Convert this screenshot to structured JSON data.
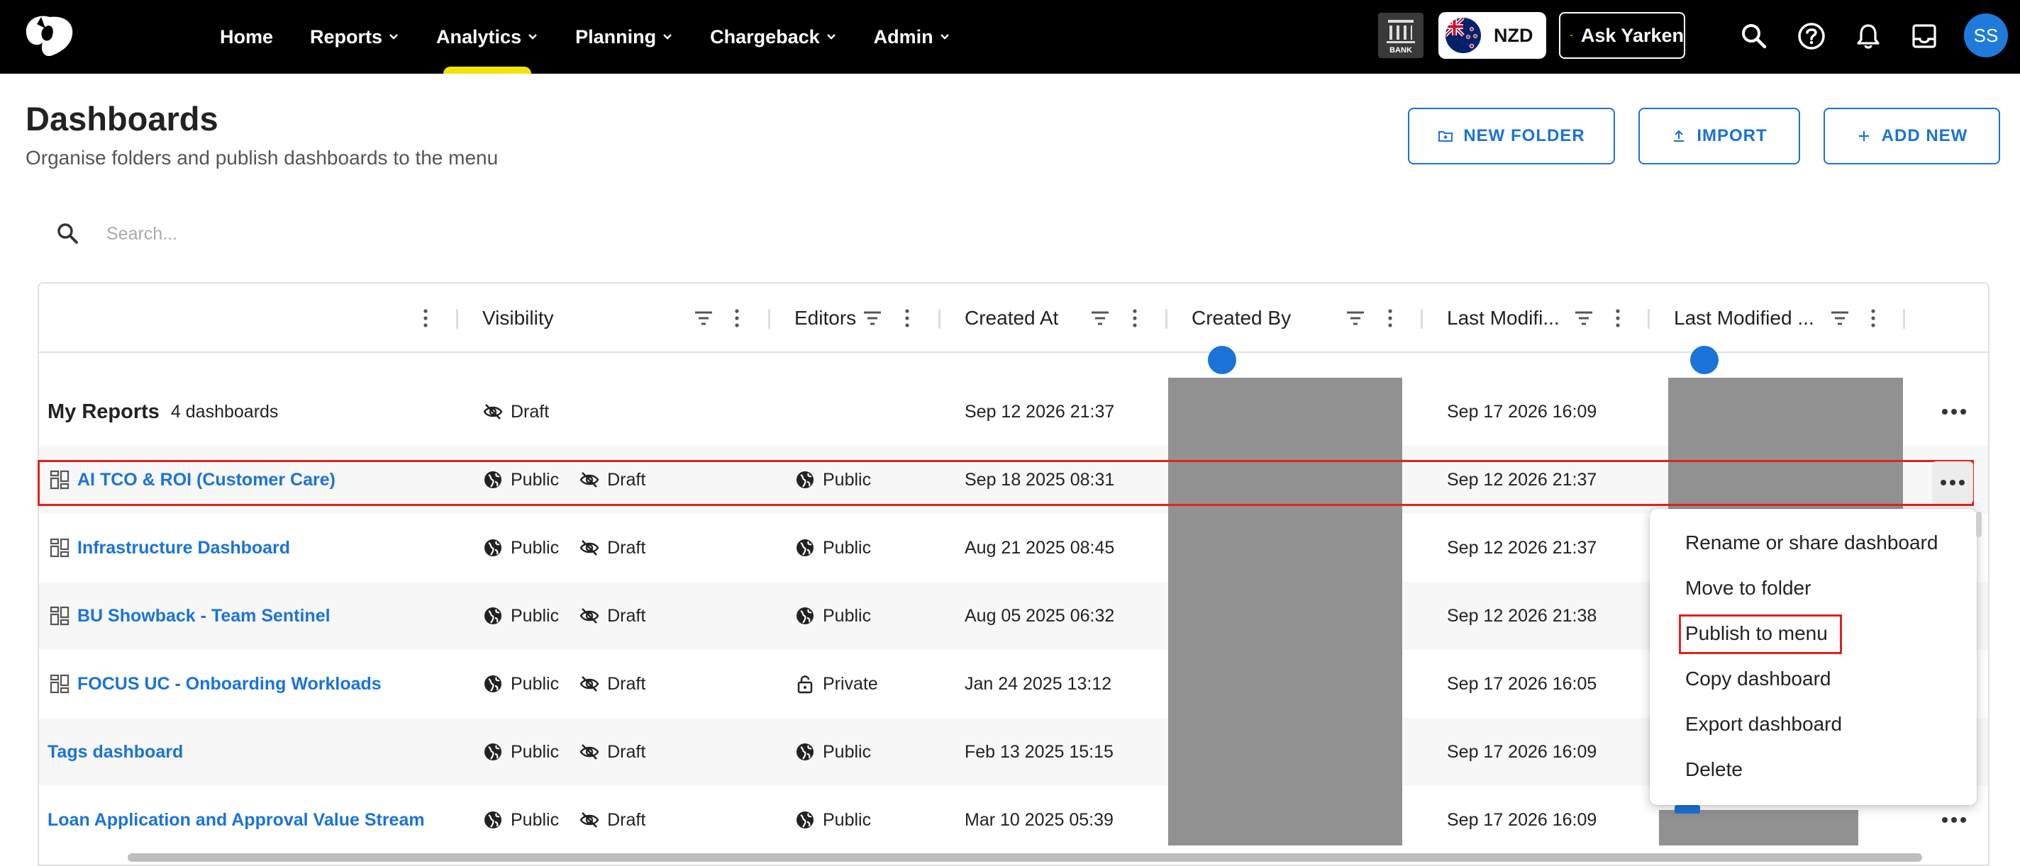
{
  "nav": {
    "items": [
      {
        "label": "Home",
        "has_menu": false,
        "active": false
      },
      {
        "label": "Reports",
        "has_menu": true,
        "active": false
      },
      {
        "label": "Analytics",
        "has_menu": true,
        "active": true
      },
      {
        "label": "Planning",
        "has_menu": true,
        "active": false
      },
      {
        "label": "Chargeback",
        "has_menu": true,
        "active": false
      },
      {
        "label": "Admin",
        "has_menu": true,
        "active": false
      }
    ],
    "bank_label": "BANK",
    "currency": "NZD",
    "ask_label": "Ask Yarken",
    "avatar_initials": "SS",
    "active_indicator_color": "#f4e20c"
  },
  "page": {
    "title": "Dashboards",
    "subtitle": "Organise folders and publish dashboards to the menu",
    "buttons": {
      "new_folder": "NEW FOLDER",
      "import": "IMPORT",
      "add_new": "ADD NEW"
    }
  },
  "search": {
    "placeholder": "Search...",
    "value": ""
  },
  "table": {
    "columns": [
      "",
      "Visibility",
      "Editors",
      "Created At",
      "Created By",
      "Last Modifi...",
      "Last Modified ..."
    ],
    "folder": {
      "name": "My Reports",
      "count": "4 dashboards",
      "visibility": "Draft",
      "created_at": "Sep 12 2026 21:37",
      "last_modified": "Sep 17 2026 16:09"
    },
    "rows": [
      {
        "name": "AI TCO & ROI (Customer Care)",
        "in_folder": true,
        "visibility_public": "Public",
        "visibility_draft": "Draft",
        "editors": "Public",
        "editors_icon": "globe-icon",
        "created_at": "Sep 18 2025 08:31",
        "last_modified": "Sep 12 2026 21:37",
        "selected": true
      },
      {
        "name": "Infrastructure Dashboard",
        "in_folder": true,
        "visibility_public": "Public",
        "visibility_draft": "Draft",
        "editors": "Public",
        "editors_icon": "globe-icon",
        "created_at": "Aug 21 2025 08:45",
        "last_modified": "Sep 12 2026 21:37",
        "selected": false
      },
      {
        "name": "BU Showback - Team Sentinel",
        "in_folder": true,
        "visibility_public": "Public",
        "visibility_draft": "Draft",
        "editors": "Public",
        "editors_icon": "globe-icon",
        "created_at": "Aug 05 2025 06:32",
        "last_modified": "Sep 12 2026 21:38",
        "selected": false
      },
      {
        "name": "FOCUS UC - Onboarding Workloads",
        "in_folder": true,
        "visibility_public": "Public",
        "visibility_draft": "Draft",
        "editors": "Private",
        "editors_icon": "lock-icon",
        "created_at": "Jan 24 2025 13:12",
        "last_modified": "Sep 17 2026 16:05",
        "selected": false
      },
      {
        "name": "Tags dashboard",
        "in_folder": false,
        "visibility_public": "Public",
        "visibility_draft": "Draft",
        "editors": "Public",
        "editors_icon": "globe-icon",
        "created_at": "Feb 13 2025 15:15",
        "last_modified": "Sep 17 2026 16:09",
        "selected": false
      },
      {
        "name": "Loan Application and Approval Value Stream",
        "in_folder": false,
        "visibility_public": "Public",
        "visibility_draft": "Draft",
        "editors": "Public",
        "editors_icon": "globe-icon",
        "created_at": "Mar 10 2025 05:39",
        "last_modified": "Sep 17 2026 16:09",
        "selected": false
      }
    ]
  },
  "context_menu": {
    "items": [
      {
        "label": "Rename or share dashboard",
        "highlighted": false
      },
      {
        "label": "Move to folder",
        "highlighted": false
      },
      {
        "label": "Publish to menu",
        "highlighted": true
      },
      {
        "label": "Copy dashboard",
        "highlighted": false
      },
      {
        "label": "Export dashboard",
        "highlighted": false
      },
      {
        "label": "Delete",
        "highlighted": false
      }
    ]
  },
  "colors": {
    "link": "#1a73d9",
    "highlight_outline": "#e2231a",
    "redaction": "#919191",
    "topbar": "#000000"
  }
}
